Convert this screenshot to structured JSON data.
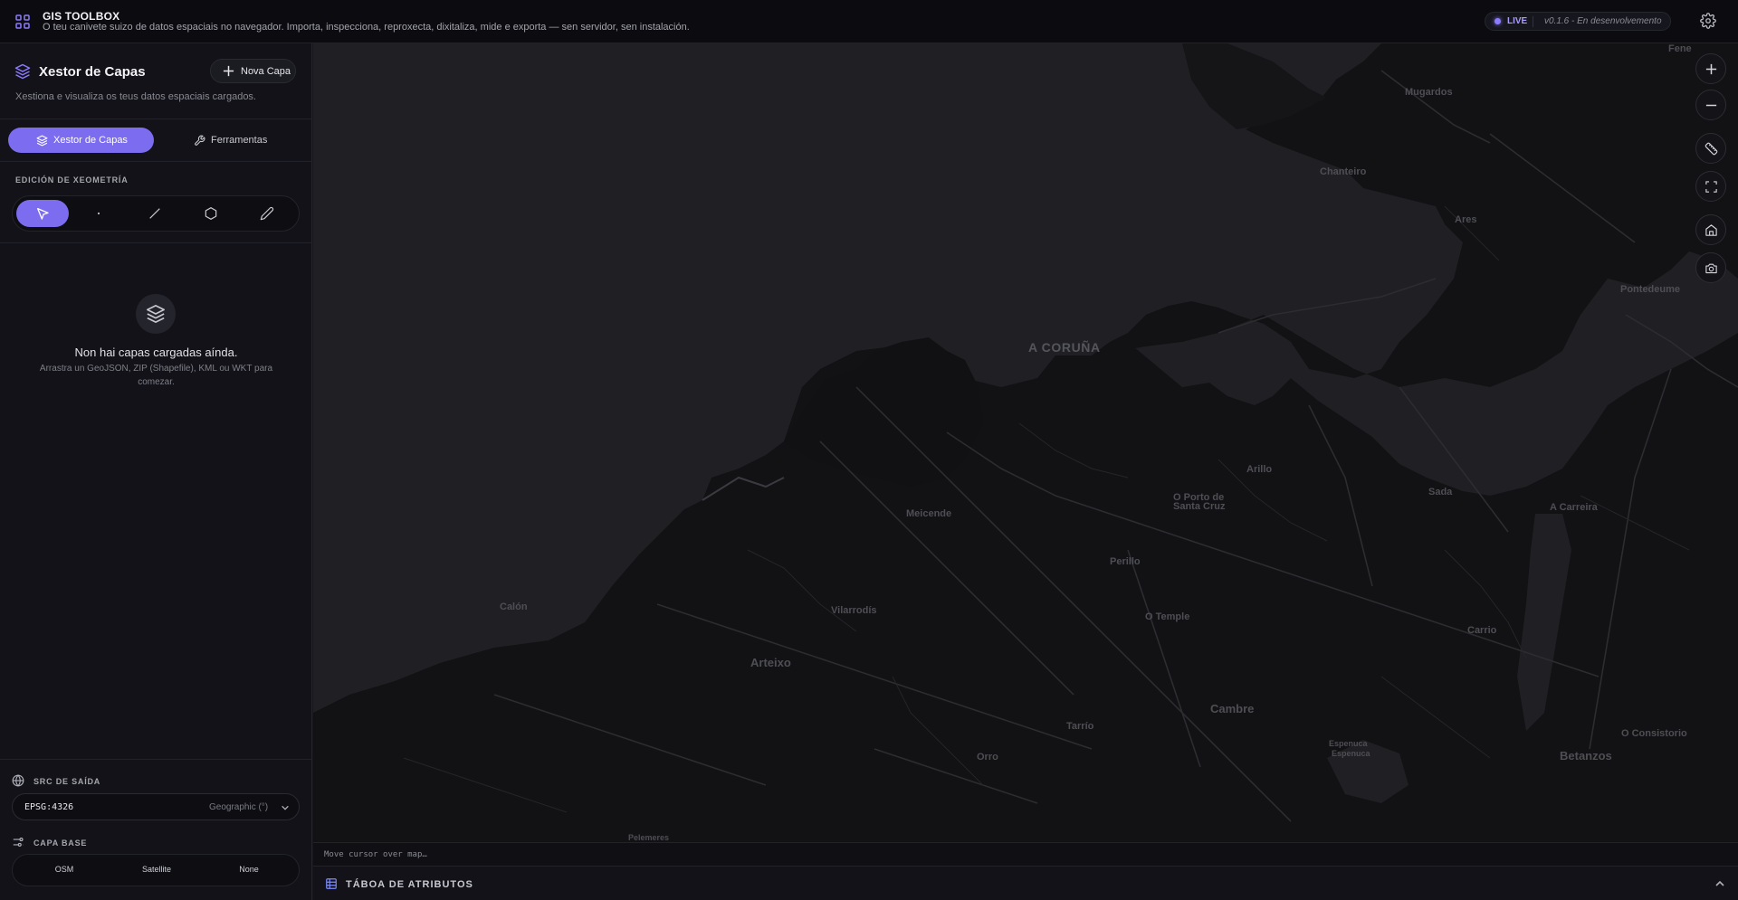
{
  "header": {
    "title": "GIS TOOLBOX",
    "subtitle": "O teu canivete suizo de datos espaciais no navegador. Importa, inspecciona, reproxecta, dixitaliza, mide e exporta — sen servidor, sen instalación.",
    "status_label": "LIVE",
    "version": "v0.1.6 - En desenvolvemento",
    "accent_color": "#7c6cf0",
    "icons": [
      "grid-icon",
      "gear-icon"
    ]
  },
  "sidebar": {
    "title": "Xestor de Capas",
    "subtitle": "Xestiona e visualiza os teus datos espaciais cargados.",
    "new_layer_label": "Nova Capa",
    "tabs": [
      {
        "label": "Xestor de Capas",
        "active": true
      },
      {
        "label": "Ferramentas",
        "active": false
      }
    ],
    "geometry_section": "EDICIÓN DE XEOMETRÍA",
    "geometry_tools": [
      "select",
      "point",
      "line",
      "polygon",
      "freehand"
    ],
    "empty_title": "Non hai capas cargadas aínda.",
    "empty_hint": "Arrastra un GeoJSON, ZIP (Shapefile), KML ou WKT para comezar.",
    "src_section": "SRC DE SAÍDA",
    "src_value": "EPSG:4326",
    "src_desc": "Geographic (°)",
    "base_section": "CAPA BASE",
    "base_options": [
      "OSM",
      "Satellite",
      "None"
    ]
  },
  "map": {
    "places": {
      "coruna": "A CORUÑA",
      "mugardos": "Mugardos",
      "chanteiro": "Chanteiro",
      "ares": "Ares",
      "pontedeume": "Pontedeume",
      "fene": "Fene",
      "arillo": "Arillo",
      "santacruz1": "O Porto de",
      "santacruz2": "Santa Cruz",
      "sada": "Sada",
      "carreira": "A Carreira",
      "meicende": "Meicende",
      "perillo": "Perillo",
      "temple": "O Temple",
      "vilarrodis": "Vilarrodís",
      "calon": "Calón",
      "arteixo": "Arteixo",
      "carrio": "Carrio",
      "cambre": "Cambre",
      "tarrio": "Tarrío",
      "orro": "Orro",
      "betanzos": "Betanzos",
      "consistorio": "O Consistorio",
      "espenuca1": "Espenuca",
      "espenuca2": "Espenuca",
      "bottom": "Pelemeres"
    },
    "controls": [
      "zoom-in",
      "zoom-out",
      "measure",
      "fullscreen",
      "home",
      "screenshot"
    ],
    "coords_placeholder": "Move cursor over map…"
  },
  "attribute_table": {
    "label": "TÁBOA DE ATRIBUTOS"
  }
}
